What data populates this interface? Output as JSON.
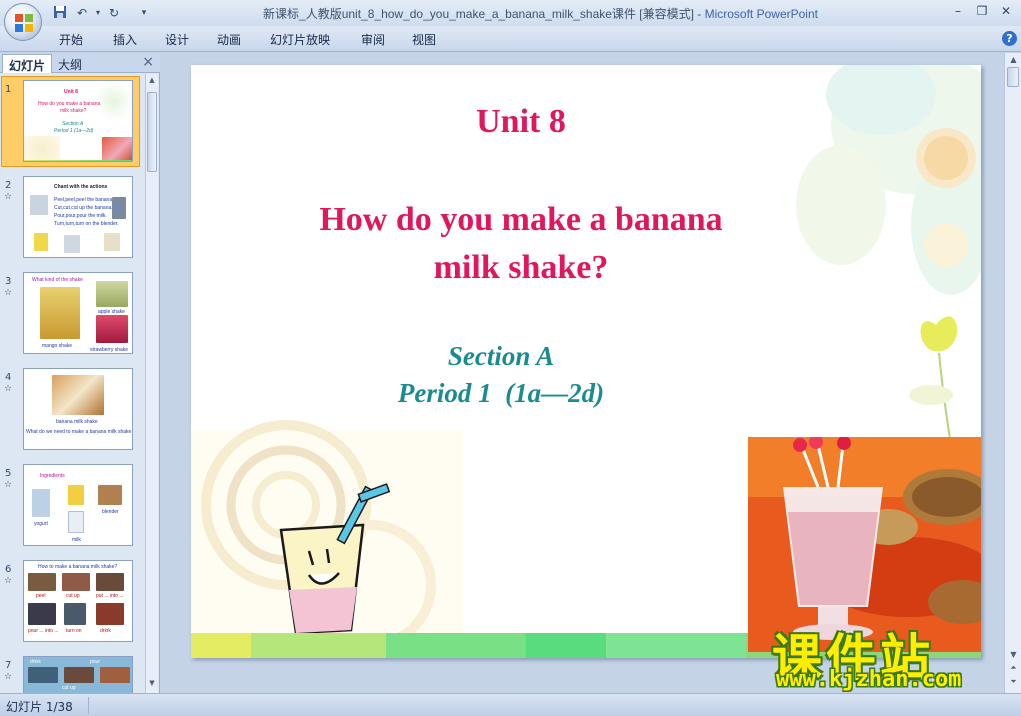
{
  "window": {
    "title": "新课标_人教版unit_8_how_do_you_make_a_banana_milk_shake课件 [兼容模式]",
    "app_name": "Microsoft PowerPoint",
    "separator": " - "
  },
  "menu": [
    "开始",
    "插入",
    "设计",
    "动画",
    "幻灯片放映",
    "审阅",
    "视图"
  ],
  "left_pane": {
    "tabs": [
      "幻灯片",
      "大纲"
    ],
    "close": "×",
    "thumbnails": [
      {
        "num": "1",
        "lines": [
          "Unit 8",
          "How do you make a banana",
          "milk shake?",
          "Section A",
          "Period 1  (1a—2d)"
        ]
      },
      {
        "num": "2",
        "lines": [
          "Chant with the actions",
          "Peel,peel,peel the banana.",
          "Cut,cut,cut up the banana.",
          "Pour,pour,pour the milk.",
          "Turn,turn,turn on the blender."
        ]
      },
      {
        "num": "3",
        "lines": [
          "What kind of the shake",
          "apple shake",
          "mango shake",
          "strawberry shake"
        ]
      },
      {
        "num": "4",
        "lines": [
          "banana milk shake",
          "What do we need to make a banana milk shake"
        ]
      },
      {
        "num": "5",
        "lines": [
          "Ingredients",
          "blender",
          "yogurt",
          "milk"
        ]
      },
      {
        "num": "6",
        "lines": [
          "How to make a banana milk shake?",
          "peel",
          "cut up",
          "put ... into ...",
          "pour ... into ...",
          "turn on",
          "drink"
        ]
      },
      {
        "num": "7",
        "lines": [
          "drink",
          "pour",
          "cut up"
        ]
      }
    ]
  },
  "slide": {
    "title": "Unit 8",
    "question_line1": "How do you make a banana",
    "question_line2": "milk shake?",
    "section": "Section A",
    "period": "Period 1  (1a—2d)"
  },
  "status": {
    "slide_counter": "幻灯片 1/38"
  },
  "watermark": {
    "cn": "课件站",
    "url": "www.kjzhan.com"
  },
  "colors": {
    "title_pink": "#e0175e",
    "section_teal": "#1a8b8e",
    "selected_thumb": "#ffcc66"
  }
}
